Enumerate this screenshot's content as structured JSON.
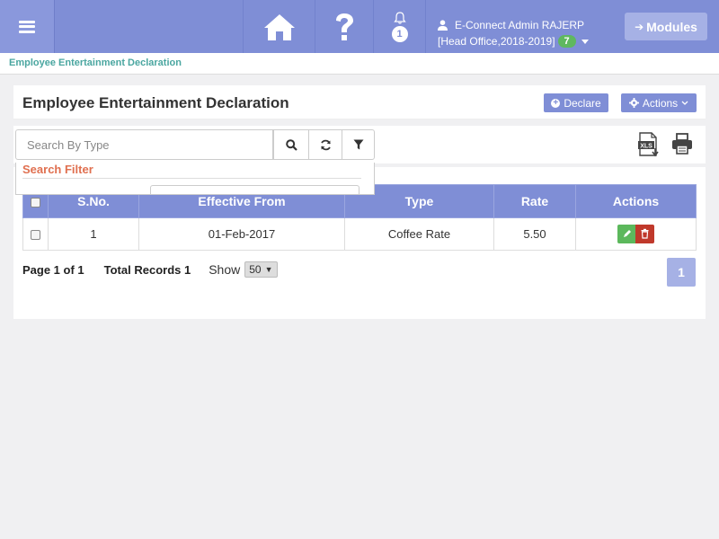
{
  "navbar": {
    "user_name": "E-Connect Admin RAJERP",
    "context": "[Head Office,2018-2019]",
    "year_badge": "7",
    "notification_count": "1",
    "modules_label": "Modules",
    "brand_color": "#7f8ed6"
  },
  "breadcrumb": "Employee Entertainment Declaration",
  "panel": {
    "title": "Employee Entertainment Declaration",
    "declare_label": "Declare",
    "actions_label": "Actions"
  },
  "toolbar": {
    "search_placeholder": "Search By Type",
    "search_value": ""
  },
  "filter": {
    "title": "Search Filter"
  },
  "table": {
    "headers": [
      "S.No.",
      "Effective From",
      "Type",
      "Rate",
      "Actions"
    ],
    "rows": [
      {
        "sno": "1",
        "effective_from": "01-Feb-2017",
        "type": "Coffee Rate",
        "rate": "5.50"
      }
    ]
  },
  "pager": {
    "page_info": "Page 1 of 1",
    "total_records": "Total Records 1",
    "show_label": "Show",
    "page_size": "50",
    "current_page": "1"
  },
  "icons": [
    "menu-icon",
    "home-icon",
    "help-icon",
    "bell-icon",
    "user-icon",
    "arrow-right-icon",
    "plus-circle-icon",
    "gear-icon",
    "chevron-down-icon",
    "search-icon",
    "refresh-icon",
    "filter-icon",
    "xls-export-icon",
    "print-icon",
    "pencil-icon",
    "trash-icon"
  ]
}
